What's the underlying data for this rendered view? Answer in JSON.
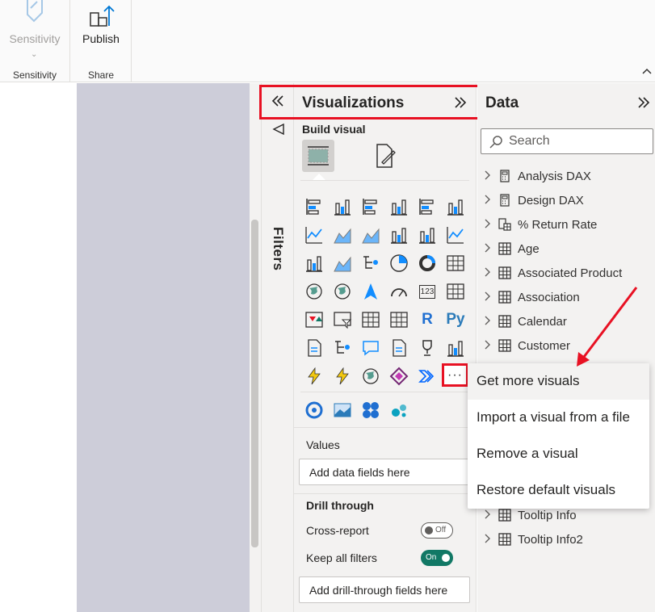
{
  "ribbon": {
    "sensitivity_button": "Sensitivity",
    "sensitivity_group": "Sensitivity",
    "publish_button": "Publish",
    "share_group": "Share"
  },
  "filters": {
    "label": "Filters"
  },
  "visualizations": {
    "title": "Visualizations",
    "build_visual": "Build visual",
    "more_button": "···",
    "values_label": "Values",
    "values_placeholder": "Add data fields here",
    "drill_through_label": "Drill through",
    "cross_report_label": "Cross-report",
    "cross_report_toggle": "Off",
    "keep_filters_label": "Keep all filters",
    "keep_filters_toggle": "On",
    "drill_placeholder": "Add drill-through fields here",
    "icon_rows": [
      [
        "stacked-bar-chart-icon",
        "stacked-column-chart-icon",
        "clustered-bar-chart-icon",
        "clustered-column-chart-icon",
        "100-stacked-bar-chart-icon",
        "100-stacked-column-chart-icon"
      ],
      [
        "line-chart-icon",
        "area-chart-icon",
        "stacked-area-chart-icon",
        "line-and-stacked-column-chart-icon",
        "line-and-clustered-column-chart-icon",
        "ribbon-chart-icon"
      ],
      [
        "waterfall-chart-icon",
        "funnel-chart-icon",
        "scatter-chart-icon",
        "pie-chart-icon",
        "donut-chart-icon",
        "treemap-icon"
      ],
      [
        "map-icon",
        "filled-map-icon",
        "azure-map-icon",
        "gauge-icon",
        "card-icon",
        "multi-row-card-icon"
      ],
      [
        "kpi-icon",
        "slicer-icon",
        "table-icon",
        "matrix-icon",
        "r-script-visual-icon",
        "python-visual-icon"
      ],
      [
        "key-influencers-icon",
        "decomposition-tree-icon",
        "qa-icon",
        "smart-narrative-icon",
        "metrics-icon",
        "paginated-report-icon"
      ],
      [
        "power-apps-icon",
        "power-automate-icon",
        "arcgis-map-icon",
        "powerapps-visual-icon",
        "power-automate-visual-icon"
      ]
    ],
    "custom_icons": [
      "custom-visual-1-icon",
      "custom-visual-2-icon",
      "custom-visual-3-icon",
      "custom-visual-4-icon"
    ],
    "text_icon_labels": {
      "r": "R",
      "py": "Py",
      "card": "123"
    }
  },
  "data_pane": {
    "title": "Data",
    "search_placeholder": "Search",
    "tables": [
      {
        "name": "Analysis DAX",
        "icon": "calculator-icon"
      },
      {
        "name": "Design DAX",
        "icon": "calculator-icon"
      },
      {
        "name": "% Return Rate",
        "icon": "calculator-table-icon"
      },
      {
        "name": "Age",
        "icon": "table-icon"
      },
      {
        "name": "Associated Product",
        "icon": "table-icon"
      },
      {
        "name": "Association",
        "icon": "table-icon"
      },
      {
        "name": "Calendar",
        "icon": "table-icon"
      },
      {
        "name": "Customer",
        "icon": "table-icon"
      }
    ],
    "tables_bottom": [
      {
        "name": "Tooltip Info",
        "icon": "table-icon"
      },
      {
        "name": "Tooltip Info2",
        "icon": "table-icon"
      }
    ]
  },
  "context_menu": {
    "items": [
      "Get more visuals",
      "Import a visual from a file",
      "Remove a visual",
      "Restore default visuals"
    ]
  },
  "colors": {
    "highlight": "#e81123",
    "pane_bg": "#f3f2f1",
    "canvas_gray": "#cdcdd9",
    "accent_blue": "#118dff",
    "toggle_on": "#117865"
  }
}
